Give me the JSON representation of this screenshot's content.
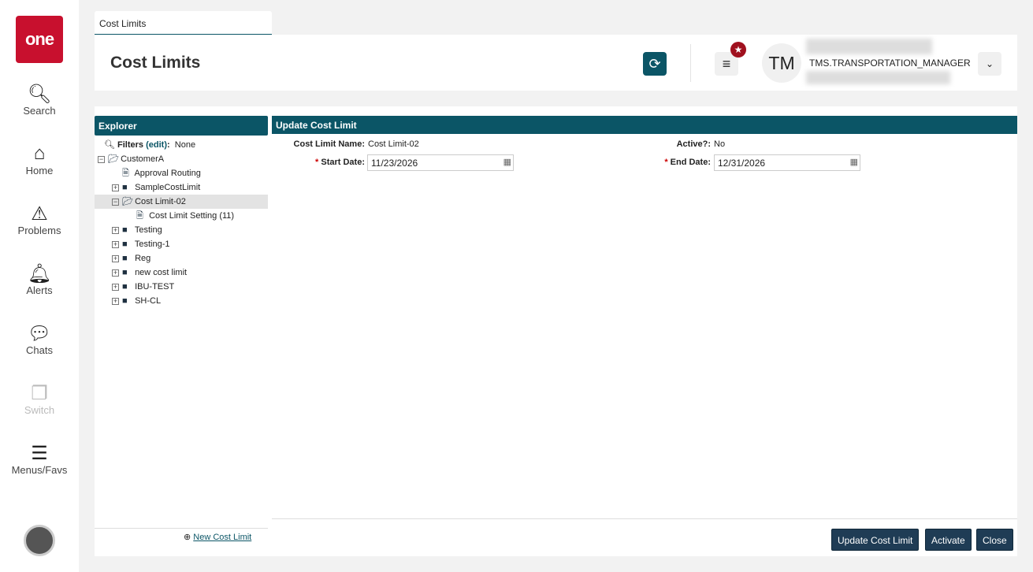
{
  "sidebar": {
    "logo": "one",
    "items": [
      {
        "label": "Search",
        "icon": "search-icon"
      },
      {
        "label": "Home",
        "icon": "home-icon"
      },
      {
        "label": "Problems",
        "icon": "warning-icon"
      },
      {
        "label": "Alerts",
        "icon": "bell-icon"
      },
      {
        "label": "Chats",
        "icon": "chat-icon"
      },
      {
        "label": "Switch",
        "icon": "switch-icon",
        "disabled": true
      },
      {
        "label": "Menus/Favs",
        "icon": "menu-icon"
      }
    ]
  },
  "tab": {
    "label": "Cost Limits"
  },
  "header": {
    "title": "Cost Limits",
    "avatar_initials": "TM",
    "user": "TMS.TRANSPORTATION_MANAGER"
  },
  "explorer": {
    "title": "Explorer",
    "filters_label": "Filters",
    "filters_edit": "(edit)",
    "filters_value": "None",
    "new_label": "New Cost Limit",
    "tree": [
      {
        "label": "CustomerA",
        "type": "folder-open",
        "level": 0,
        "toggle": "-"
      },
      {
        "label": "Approval Routing",
        "type": "file",
        "level": 1,
        "toggle": ""
      },
      {
        "label": "SampleCostLimit",
        "type": "folder",
        "level": 1,
        "toggle": "+"
      },
      {
        "label": "Cost Limit-02",
        "type": "folder-open",
        "level": 1,
        "toggle": "-",
        "selected": true
      },
      {
        "label": "Cost Limit Setting (11)",
        "type": "file",
        "level": 2,
        "toggle": ""
      },
      {
        "label": "Testing",
        "type": "folder",
        "level": 1,
        "toggle": "+"
      },
      {
        "label": "Testing-1",
        "type": "folder",
        "level": 1,
        "toggle": "+"
      },
      {
        "label": "Reg",
        "type": "folder",
        "level": 1,
        "toggle": "+"
      },
      {
        "label": "new cost limit",
        "type": "folder",
        "level": 1,
        "toggle": "+"
      },
      {
        "label": "IBU-TEST",
        "type": "folder",
        "level": 1,
        "toggle": "+"
      },
      {
        "label": "SH-CL",
        "type": "folder",
        "level": 1,
        "toggle": "+"
      }
    ]
  },
  "form": {
    "title": "Update Cost Limit",
    "name_label": "Cost Limit Name:",
    "name_value": "Cost Limit-02",
    "active_label": "Active?:",
    "active_value": "No",
    "start_label": "Start Date:",
    "start_value": "11/23/2026",
    "end_label": "End Date:",
    "end_value": "12/31/2026",
    "required_mark": "*"
  },
  "buttons": {
    "update": "Update Cost Limit",
    "activate": "Activate",
    "close": "Close"
  }
}
